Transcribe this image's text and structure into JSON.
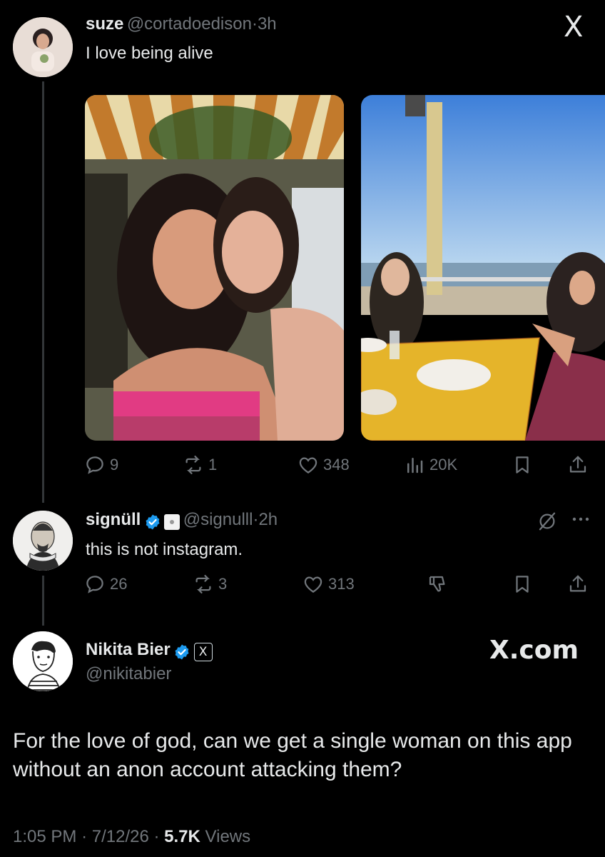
{
  "tweet1": {
    "name": "suze",
    "handle": "@cortadoedison",
    "time": "3h",
    "separator": "·",
    "text": "I love being alive",
    "replies": "9",
    "reposts": "1",
    "likes": "348",
    "views": "20K"
  },
  "tweet2": {
    "name": "signüll",
    "handle": "@signulll",
    "time": "2h",
    "separator": "·",
    "text": "this is not instagram.",
    "replies": "26",
    "reposts": "3",
    "likes": "313"
  },
  "tweet3": {
    "name": "Nikita Bier",
    "handle": "@nikitabier",
    "brand": "X.com",
    "text": "For the love of god, can we get a single woman on this app without an anon account attacking them?",
    "time": "1:05 PM",
    "date": "7/12/26",
    "separator": "·",
    "views_count": "5.7K",
    "views_label": "Views"
  },
  "top_right_logo": "X",
  "colors": {
    "background": "#000000",
    "text": "#e7e9ea",
    "muted": "#71767b",
    "verified": "#1d9bf0",
    "thread_line": "#333639"
  },
  "icons": [
    "reply-icon",
    "repost-icon",
    "like-icon",
    "views-icon",
    "bookmark-icon",
    "share-icon",
    "grok-icon",
    "more-icon",
    "downvote-icon",
    "verified-icon"
  ]
}
